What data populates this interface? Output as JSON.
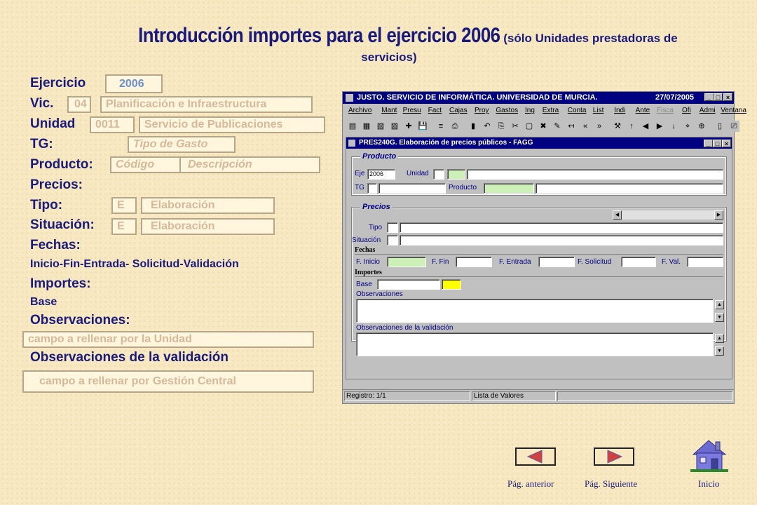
{
  "heading": {
    "main": "Introducción importes para el ejercicio 2006",
    "paren": "(sólo Unidades prestadoras de",
    "paren2": "servicios)"
  },
  "form": {
    "ejercicio": {
      "label": "Ejercicio",
      "value": "2006"
    },
    "vic": {
      "label": "Vic.",
      "code": "04",
      "desc": "Planificación e Infraestructura"
    },
    "unidad": {
      "label": "Unidad",
      "code": "0011",
      "desc": "Servicio de Publicaciones"
    },
    "tg": {
      "label": "TG:",
      "value": "Tipo de Gasto"
    },
    "producto": {
      "label": "Producto:",
      "code": "Código",
      "desc": "Descripción"
    },
    "precios": {
      "label": "Precios:"
    },
    "tipo": {
      "label": "Tipo:",
      "code": "E",
      "desc": "Elaboración"
    },
    "situacion": {
      "label": "Situación:",
      "code": "E",
      "desc": "Elaboración"
    },
    "fechas": {
      "label": "Fechas:",
      "detail": "Inicio-Fin-Entrada- Solicitud-Validación"
    },
    "importes": {
      "label": "Importes:",
      "detail": "Base"
    },
    "observaciones": {
      "label": "Observaciones:",
      "value": "campo a rellenar por la Unidad"
    },
    "obs_validacion": {
      "label": "Observaciones de la validación",
      "value": "campo a rellenar por Gestión Central"
    }
  },
  "app": {
    "title": "JUSTO. SERVICIO DE INFORMÁTICA. UNIVERSIDAD DE MURCIA.",
    "date": "27/07/2005",
    "menu": [
      "Archivo",
      "Mant",
      "Presu",
      "Fact",
      "Cajas",
      "Proy",
      "Gastos",
      "Ing",
      "Extra",
      "Conta",
      "List",
      "Indi",
      "Ante",
      "Fisca",
      "Ofi",
      "Admi",
      "Ventana"
    ],
    "inner_title": "PRES240G. Elaboración de precios públicos - FAGG",
    "producto_group": "Producto",
    "precios_group": "Precios",
    "eje_label": "Eje",
    "eje_value": "2006",
    "unidad_label": "Unidad",
    "tg_label": "TG",
    "producto_label": "Producto",
    "tipo_label": "Tipo",
    "situacion_label": "Situación",
    "fechas_label": "Fechas",
    "finicio_label": "F. Inicio",
    "ffin_label": "F. Fin",
    "fentrada_label": "F. Entrada",
    "fsolicitud_label": "F. Solicitud",
    "fval_label": "F. Val.",
    "importes_label": "Importes",
    "base_label": "Base",
    "observaciones_label": "Observaciones",
    "obs_validacion_label": "Observaciones de la validación",
    "status_registro": "Registro: 1/1",
    "status_lista": "Lista de Valores"
  },
  "nav": {
    "prev": "Pág. anterior",
    "next": "Pág. Siguiente",
    "home": "Inicio"
  },
  "colors": {
    "background": "#f7e8c2",
    "label_blue": "#1a1a7a",
    "field_text": "#d8b89a",
    "win_title": "#000080",
    "arrow_red": "#d04040"
  }
}
